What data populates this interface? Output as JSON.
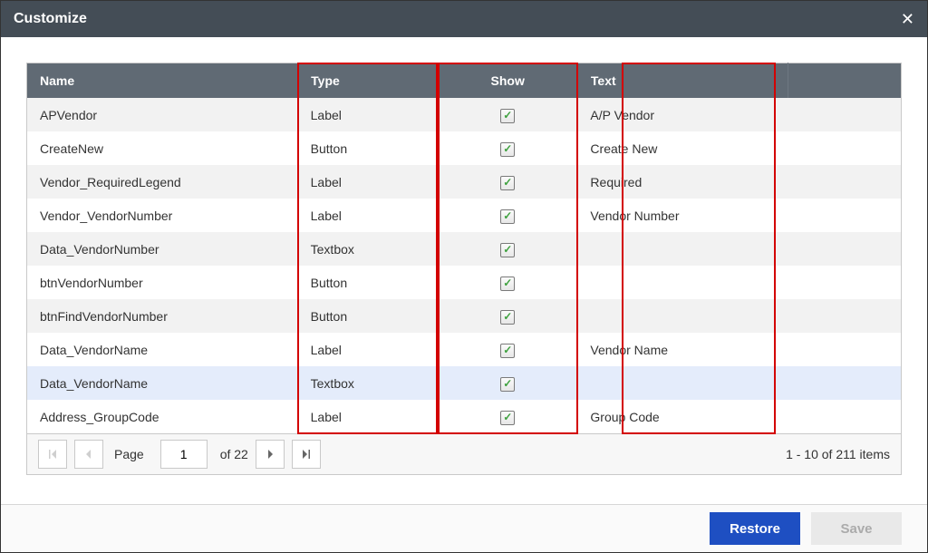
{
  "dialog": {
    "title": "Customize",
    "close_symbol": "✕"
  },
  "table": {
    "headers": {
      "name": "Name",
      "type": "Type",
      "show": "Show",
      "text": "Text"
    },
    "rows": [
      {
        "name": "APVendor",
        "type": "Label",
        "show": true,
        "text": "A/P Vendor",
        "selected": false
      },
      {
        "name": "CreateNew",
        "type": "Button",
        "show": true,
        "text": "Create New",
        "selected": false
      },
      {
        "name": "Vendor_RequiredLegend",
        "type": "Label",
        "show": true,
        "text": "Required",
        "selected": false
      },
      {
        "name": "Vendor_VendorNumber",
        "type": "Label",
        "show": true,
        "text": "Vendor Number",
        "selected": false
      },
      {
        "name": "Data_VendorNumber",
        "type": "Textbox",
        "show": true,
        "text": "",
        "selected": false
      },
      {
        "name": "btnVendorNumber",
        "type": "Button",
        "show": true,
        "text": "",
        "selected": false
      },
      {
        "name": "btnFindVendorNumber",
        "type": "Button",
        "show": true,
        "text": "",
        "selected": false
      },
      {
        "name": "Data_VendorName",
        "type": "Label",
        "show": true,
        "text": "Vendor Name",
        "selected": false
      },
      {
        "name": "Data_VendorName",
        "type": "Textbox",
        "show": true,
        "text": "",
        "selected": true
      },
      {
        "name": "Address_GroupCode",
        "type": "Label",
        "show": true,
        "text": "Group Code",
        "selected": false
      }
    ],
    "check_symbol": "✓"
  },
  "pager": {
    "page_label": "Page",
    "current_page": "1",
    "of_label": "of 22",
    "items_label": "1 - 10 of 211 items"
  },
  "footer": {
    "restore_label": "Restore",
    "save_label": "Save"
  }
}
